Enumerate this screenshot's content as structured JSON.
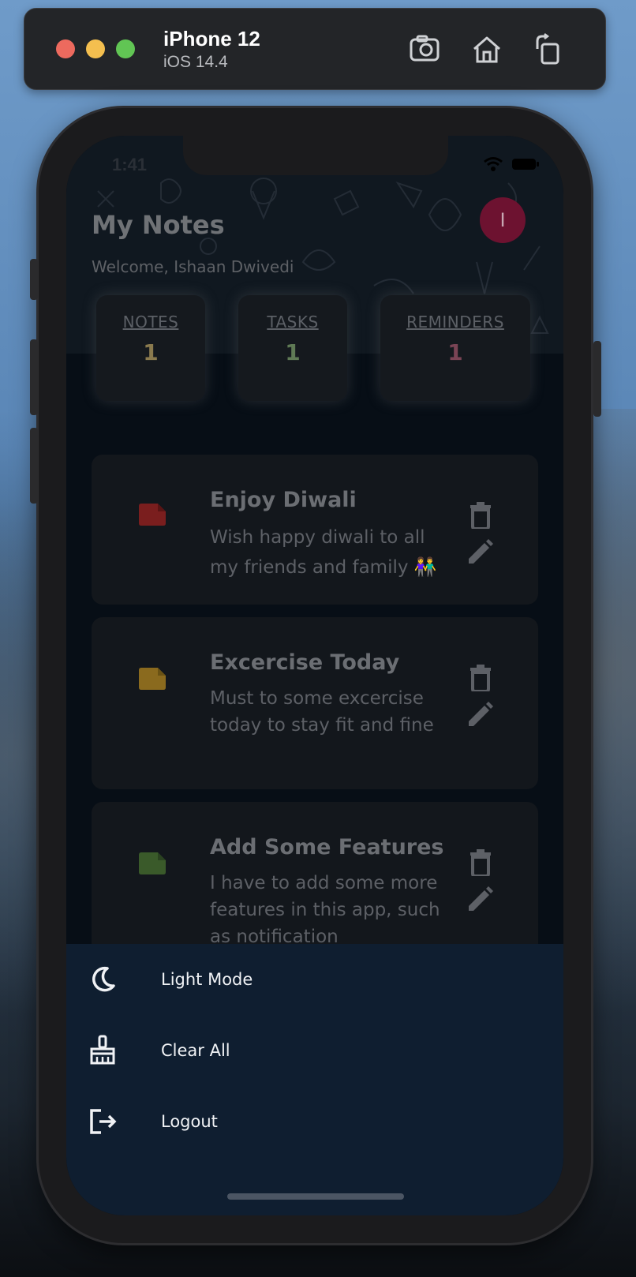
{
  "simulator": {
    "device": "iPhone 12",
    "os": "iOS 14.4",
    "tools": [
      "screenshot-icon",
      "home-icon",
      "rotate-icon"
    ]
  },
  "status_bar": {
    "time": "1:41"
  },
  "header": {
    "title": "My Notes",
    "welcome": "Welcome, Ishaan Dwivedi",
    "avatar_initial": "I"
  },
  "stats": [
    {
      "label": "NOTES",
      "count": "1",
      "color": "#8a7a4e"
    },
    {
      "label": "TASKS",
      "count": "1",
      "color": "#5f7a55"
    },
    {
      "label": "REMINDERS",
      "count": "1",
      "color": "#7a4455"
    }
  ],
  "notes": [
    {
      "title": "Enjoy Diwali",
      "body": "Wish happy diwali to all my friends and family 👫",
      "color": "#7a1e1e"
    },
    {
      "title": "Excercise Today",
      "body": "Must to some excercise today to stay fit and fine",
      "color": "#8a6a1e"
    },
    {
      "title": "Add Some Features",
      "body": "I have to add some more features in this app, such as notification",
      "color": "#3a5a2a"
    }
  ],
  "menu": [
    {
      "label": "Light Mode",
      "icon": "moon-icon"
    },
    {
      "label": "Clear All",
      "icon": "broom-icon"
    },
    {
      "label": "Logout",
      "icon": "logout-icon"
    }
  ]
}
